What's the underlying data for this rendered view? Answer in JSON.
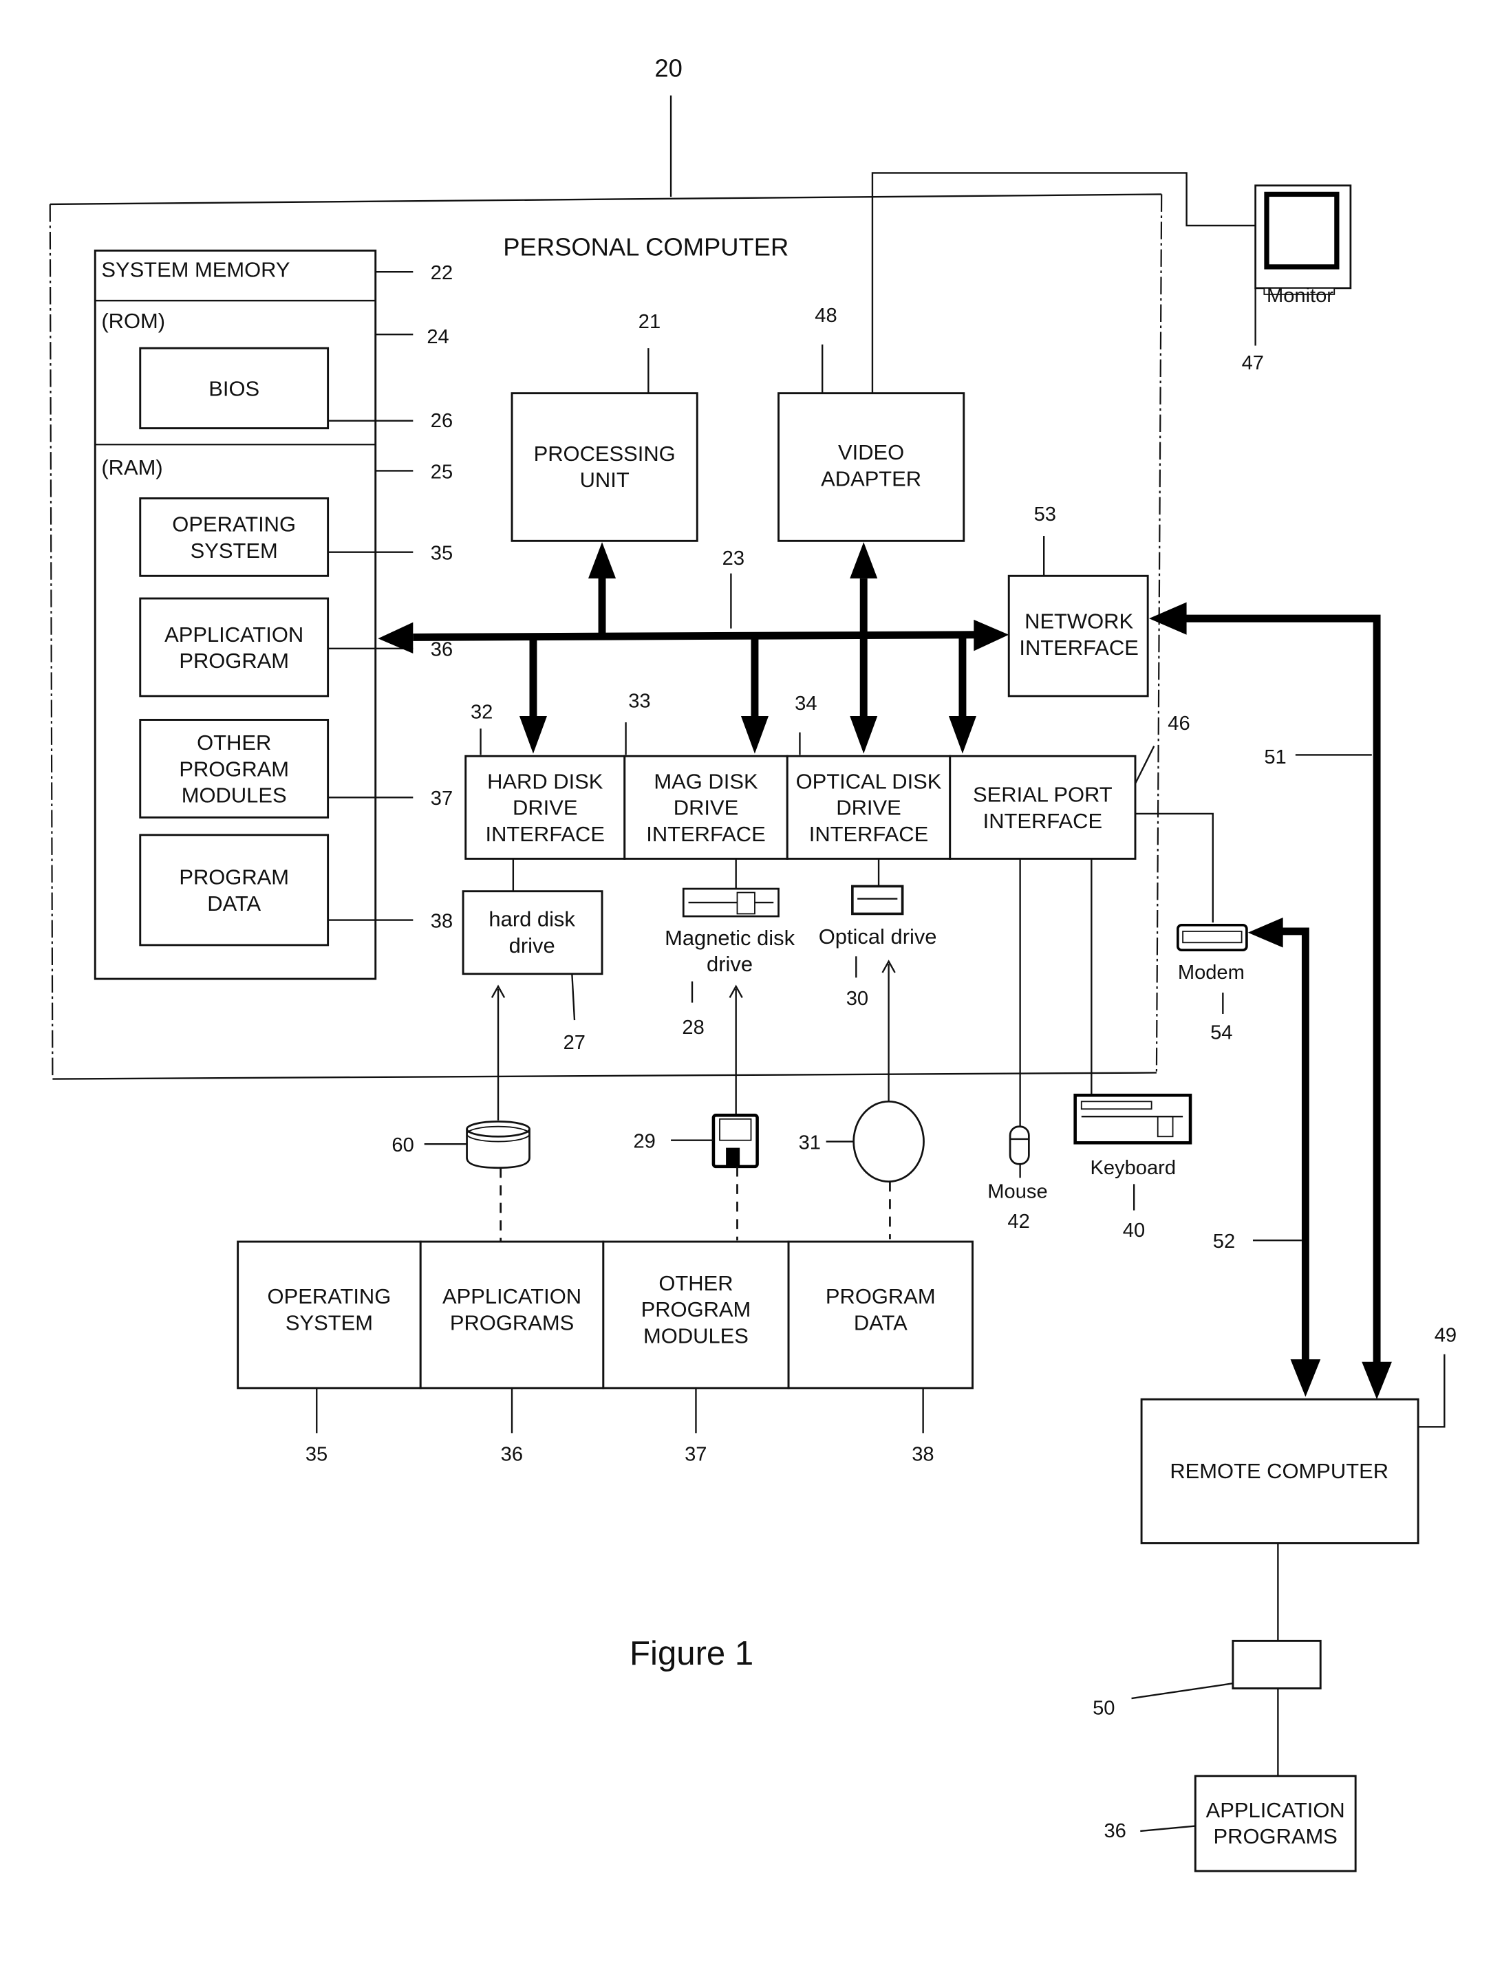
{
  "figure": {
    "caption": "Figure 1",
    "system_ref": "20",
    "system_title": "PERSONAL COMPUTER"
  },
  "memory": {
    "system_memory": {
      "label": "SYSTEM MEMORY",
      "ref": "22"
    },
    "rom": {
      "label": "(ROM)",
      "ref": "24"
    },
    "bios": {
      "label": "BIOS",
      "ref": "26"
    },
    "ram": {
      "label": "(RAM)",
      "ref": "25"
    },
    "ram_items": [
      {
        "lines": [
          "OPERATING",
          "SYSTEM"
        ],
        "ref": "35"
      },
      {
        "lines": [
          "APPLICATION",
          "PROGRAM"
        ],
        "ref": "36"
      },
      {
        "lines": [
          "OTHER",
          "PROGRAM",
          "MODULES"
        ],
        "ref": "37"
      },
      {
        "lines": [
          "PROGRAM",
          "DATA"
        ],
        "ref": "38"
      }
    ]
  },
  "processing_unit": {
    "lines": [
      "PROCESSING",
      "UNIT"
    ],
    "ref": "21"
  },
  "video_adapter": {
    "lines": [
      "VIDEO",
      "ADAPTER"
    ],
    "ref": "48"
  },
  "system_bus": {
    "ref": "23"
  },
  "network_interface": {
    "lines": [
      "NETWORK",
      "INTERFACE"
    ],
    "ref": "53"
  },
  "interfaces": [
    {
      "lines": [
        "HARD DISK",
        "DRIVE",
        "INTERFACE"
      ],
      "ref": "32"
    },
    {
      "lines": [
        "MAG DISK",
        "DRIVE",
        "INTERFACE"
      ],
      "ref": "33"
    },
    {
      "lines": [
        "OPTICAL DISK",
        "DRIVE",
        "INTERFACE"
      ],
      "ref": "34"
    },
    {
      "lines": [
        "SERIAL PORT",
        "INTERFACE"
      ],
      "ref": "46"
    }
  ],
  "drives": {
    "hard_disk": {
      "lines": [
        "hard disk",
        "drive"
      ],
      "ref": "27"
    },
    "magnetic": {
      "lines": [
        "Magnetic disk",
        "drive"
      ],
      "ref": "28"
    },
    "optical": {
      "label": "Optical drive",
      "ref": "30"
    }
  },
  "media": {
    "disk_pack": {
      "ref": "60"
    },
    "floppy": {
      "ref": "29"
    },
    "optical_disc": {
      "ref": "31"
    }
  },
  "peripherals": {
    "monitor": {
      "label": "Monitor",
      "ref": "47"
    },
    "modem": {
      "label": "Modem",
      "ref": "54"
    },
    "mouse": {
      "label": "Mouse",
      "ref": "42"
    },
    "keyboard": {
      "label": "Keyboard",
      "ref": "40"
    }
  },
  "stored_programs": [
    {
      "lines": [
        "OPERATING",
        "SYSTEM"
      ],
      "ref": "35"
    },
    {
      "lines": [
        "APPLICATION",
        "PROGRAMS"
      ],
      "ref": "36"
    },
    {
      "lines": [
        "OTHER",
        "PROGRAM",
        "MODULES"
      ],
      "ref": "37"
    },
    {
      "lines": [
        "PROGRAM",
        "DATA"
      ],
      "ref": "38"
    }
  ],
  "network": {
    "lan_ref": "51",
    "wan_ref": "52"
  },
  "remote_computer": {
    "label": "REMOTE COMPUTER",
    "ref": "49"
  },
  "remote_storage": {
    "ref": "50"
  },
  "remote_apps": {
    "lines": [
      "APPLICATION",
      "PROGRAMS"
    ],
    "ref": "36"
  }
}
